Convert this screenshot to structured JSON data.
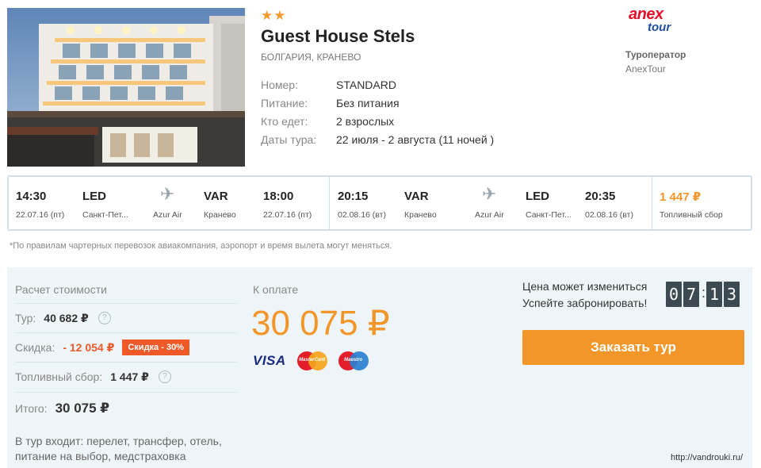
{
  "hotel": {
    "stars": "★★",
    "name": "Guest House Stels",
    "location": "БОЛГАРИЯ, КРАНЕВО",
    "details": [
      {
        "label": "Номер:",
        "value": "STANDARD"
      },
      {
        "label": "Питание:",
        "value": "Без питания"
      },
      {
        "label": "Кто едет:",
        "value": "2 взрослых"
      },
      {
        "label": "Даты тура:",
        "value": "22 июля - 2 августа (11 ночей )"
      }
    ]
  },
  "operator": {
    "logo_top": "anex",
    "logo_bottom": "tour",
    "label": "Туроператор",
    "value": "AnexTour"
  },
  "flights": {
    "outbound": {
      "dep_time": "14:30",
      "dep_date": "22.07.16 (пт)",
      "dep_code": "LED",
      "dep_city": "Санкт-Пет...",
      "airline": "Azur Air",
      "arr_code": "VAR",
      "arr_city": "Кранево",
      "arr_time": "18:00",
      "arr_date": "22.07.16 (пт)"
    },
    "return": {
      "dep_time": "20:15",
      "dep_date": "02.08.16 (вт)",
      "dep_code": "VAR",
      "dep_city": "Кранево",
      "airline": "Azur Air",
      "arr_code": "LED",
      "arr_city": "Санкт-Пет...",
      "arr_time": "20:35",
      "arr_date": "02.08.16 (вт)"
    },
    "fuel_fee": "1 447 ₽",
    "fuel_fee_label": "Топливный сбор"
  },
  "note": "*По правилам чартерных перевозок авиакомпания, аэропорт и время вылета могут меняться.",
  "calc": {
    "title": "Расчет стоимости",
    "tour_label": "Тур:",
    "tour_value": "40 682 ₽",
    "discount_label": "Скидка:",
    "discount_value": "- 12 054 ₽",
    "discount_badge": "Скидка - 30%",
    "fuel_label": "Топливный сбор:",
    "fuel_value": "1 447 ₽",
    "total_label": "Итого:",
    "total_value": "30 075 ₽",
    "help": "?",
    "includes": "В тур входит: перелет, трансфер, отель, питание на выбор, медстраховка"
  },
  "payment": {
    "label": "К оплате",
    "amount": "30 075 ₽",
    "visa": "VISA",
    "mastercard": "MasterCard",
    "maestro": "Maestro"
  },
  "booking": {
    "price_change": "Цена может измениться",
    "hurry": "Успейте забронировать!",
    "timer": [
      "0",
      "7",
      "1",
      "3"
    ],
    "button": "Заказать тур"
  },
  "watermark": "http://vandrouki.ru/",
  "colors": {
    "accent": "#f2962a",
    "discount": "#ef5a28",
    "border": "#cfe0ea",
    "panel": "#eef5f9"
  }
}
